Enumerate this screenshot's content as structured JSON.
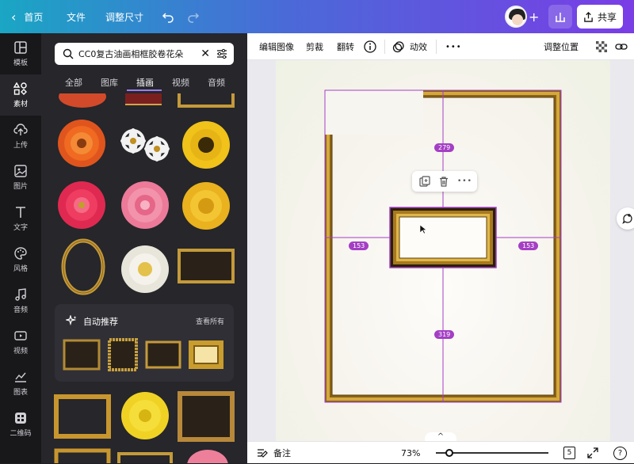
{
  "topbar": {
    "home_label": "首页",
    "file_label": "文件",
    "resize_label": "调整尺寸",
    "add_symbol": "+",
    "share_label": "共享"
  },
  "rail": {
    "items": [
      {
        "label": "模板",
        "icon": "layout-icon"
      },
      {
        "label": "素材",
        "icon": "elements-icon"
      },
      {
        "label": "上传",
        "icon": "upload-icon"
      },
      {
        "label": "图片",
        "icon": "image-icon"
      },
      {
        "label": "文字",
        "icon": "text-icon"
      },
      {
        "label": "风格",
        "icon": "palette-icon"
      },
      {
        "label": "音频",
        "icon": "music-icon"
      },
      {
        "label": "视频",
        "icon": "video-icon"
      },
      {
        "label": "图表",
        "icon": "chart-icon"
      },
      {
        "label": "二维码",
        "icon": "qr-icon"
      }
    ]
  },
  "panel": {
    "search_value": "CC0复古油画相框胶卷花朵",
    "tabs": [
      "全部",
      "图库",
      "插画",
      "视频",
      "音频"
    ],
    "active_tab": "插画",
    "recommend_title": "自动推荐",
    "see_all": "查看所有"
  },
  "toolbar": {
    "edit_image": "编辑图像",
    "crop": "剪裁",
    "flip": "翻转",
    "animate": "动效",
    "more": "•••",
    "position": "调整位置"
  },
  "canvas": {
    "guide_top": "279",
    "guide_left": "153",
    "guide_right": "153",
    "guide_bottom": "319",
    "ctx_more": "•••"
  },
  "bottombar": {
    "notes_label": "备注",
    "zoom": "73%",
    "page_count": "5",
    "help": "?",
    "expand": "^"
  },
  "colors": {
    "accent": "#a43fc4",
    "gradient_start": "#1aa6c4",
    "gradient_end": "#7a3de6",
    "frame_gold": "#b88a2c"
  }
}
